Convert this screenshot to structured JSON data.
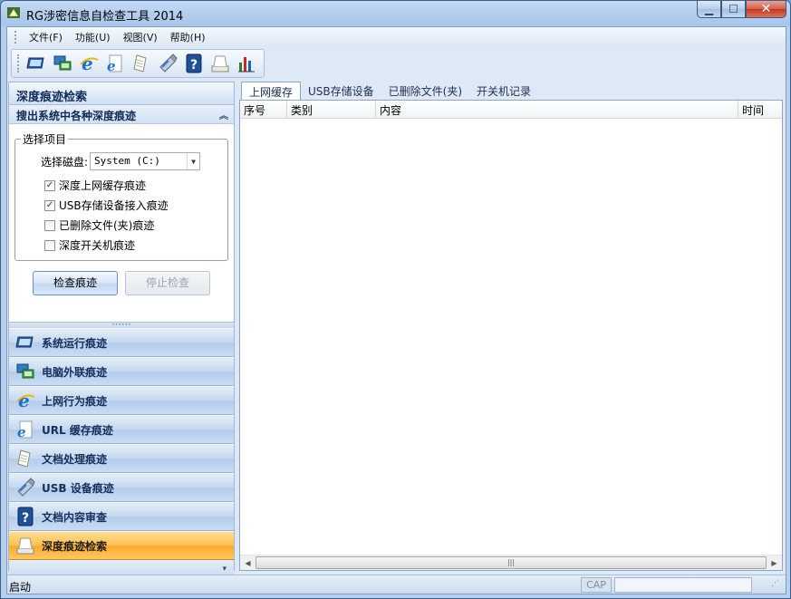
{
  "window": {
    "title": "RG涉密信息自检查工具 2014"
  },
  "menu": [
    "文件(F)",
    "功能(U)",
    "视图(V)",
    "帮助(H)"
  ],
  "toolbar": [
    "monitor-icon",
    "network-computer-icon",
    "ie-icon",
    "url-cache-icon",
    "document-icon",
    "usb-icon",
    "help-icon",
    "scan-icon",
    "chart-icon"
  ],
  "left": {
    "header": "深度痕迹检索",
    "subheader": "搜出系统中各种深度痕迹",
    "group_title": "选择项目",
    "disk_label": "选择磁盘:",
    "disk_value": "System (C:)",
    "options": [
      {
        "label": "深度上网缓存痕迹",
        "checked": true
      },
      {
        "label": "USB存储设备接入痕迹",
        "checked": true
      },
      {
        "label": "已删除文件(夹)痕迹",
        "checked": false
      },
      {
        "label": "深度开关机痕迹",
        "checked": false
      }
    ],
    "check_button": "检查痕迹",
    "stop_button": "停止检查",
    "nav": [
      {
        "label": "系统运行痕迹",
        "icon": "monitor-icon"
      },
      {
        "label": "电脑外联痕迹",
        "icon": "network-computer-icon"
      },
      {
        "label": "上网行为痕迹",
        "icon": "ie-icon"
      },
      {
        "label": "URL 缓存痕迹",
        "icon": "url-cache-icon"
      },
      {
        "label": "文档处理痕迹",
        "icon": "document-icon"
      },
      {
        "label": "USB 设备痕迹",
        "icon": "usb-icon"
      },
      {
        "label": "文档内容审查",
        "icon": "help-icon"
      },
      {
        "label": "深度痕迹检索",
        "icon": "scan-icon",
        "active": true
      }
    ]
  },
  "tabs": [
    "上网缓存",
    "USB存储设备",
    "已删除文件(夹)",
    "开关机记录"
  ],
  "columns": [
    "序号",
    "类别",
    "内容",
    "时间"
  ],
  "status": {
    "text": "启动",
    "cap": "CAP"
  }
}
